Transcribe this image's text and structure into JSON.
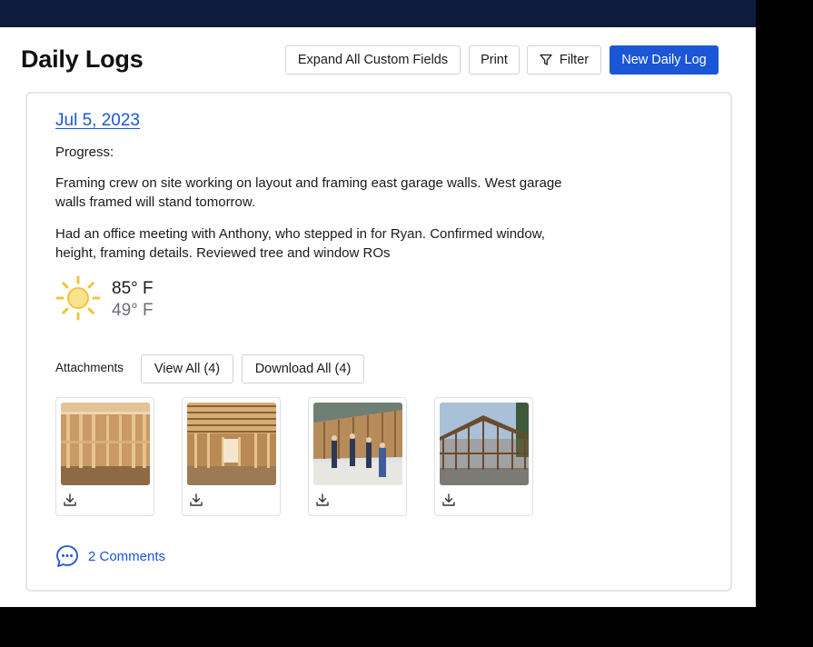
{
  "header": {
    "title": "Daily Logs",
    "buttons": {
      "expand": "Expand All Custom Fields",
      "print": "Print",
      "filter": "Filter",
      "new_log": "New Daily Log"
    }
  },
  "log": {
    "date": "Jul 5, 2023",
    "progress_label": "Progress:",
    "notes": [
      "Framing crew on site working on layout and framing east garage walls. West garage walls framed will stand tomorrow.",
      "Had an office meeting with Anthony, who stepped in for Ryan. Confirmed window, height, framing details. Reviewed tree and window ROs"
    ],
    "weather": {
      "icon": "sun-icon",
      "high": "85° F",
      "low": "49° F"
    },
    "attachments": {
      "label": "Attachments",
      "view_all": "View All (4)",
      "download_all": "Download All (4)",
      "items": [
        {
          "icon": "download-icon"
        },
        {
          "icon": "download-icon"
        },
        {
          "icon": "download-icon"
        },
        {
          "icon": "download-icon"
        }
      ]
    },
    "comments": {
      "icon": "comment-bubble-icon",
      "label": "2 Comments"
    }
  },
  "colors": {
    "topbar": "#0e1b3e",
    "accent": "#1a56d6",
    "muted_text": "#6b6f76",
    "sun": "#f0c53c"
  }
}
